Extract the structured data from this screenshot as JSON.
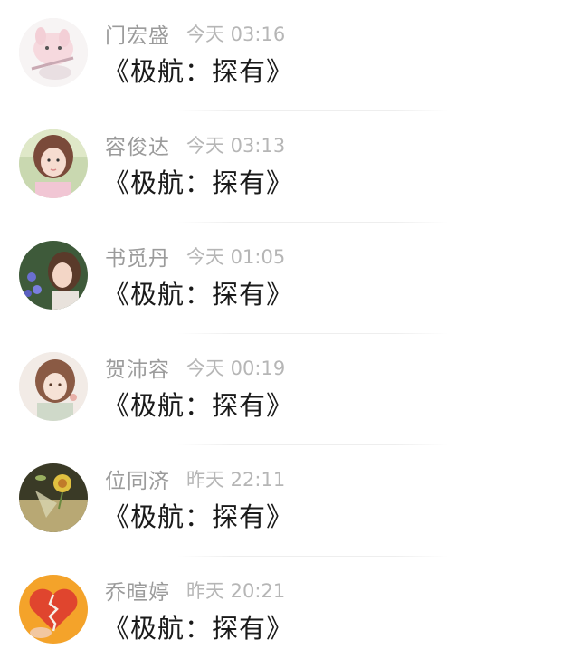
{
  "feed": {
    "items": [
      {
        "name": "门宏盛",
        "time": "今天 03:16",
        "message": "《极航：探有》",
        "avatar": "avatar-cartoon-rabbit"
      },
      {
        "name": "容俊达",
        "time": "今天 03:13",
        "message": "《极航：探有》",
        "avatar": "avatar-girl-portrait"
      },
      {
        "name": "书觅丹",
        "time": "今天 01:05",
        "message": "《极航：探有》",
        "avatar": "avatar-girl-flowers"
      },
      {
        "name": "贺沛容",
        "time": "今天 00:19",
        "message": "《极航：探有》",
        "avatar": "avatar-anime-girl"
      },
      {
        "name": "位同济",
        "time": "昨天 22:11",
        "message": "《极航：探有》",
        "avatar": "avatar-flower-glass"
      },
      {
        "name": "乔暄婷",
        "time": "昨天 20:21",
        "message": "《极航：探有》",
        "avatar": "avatar-broken-heart"
      }
    ]
  }
}
